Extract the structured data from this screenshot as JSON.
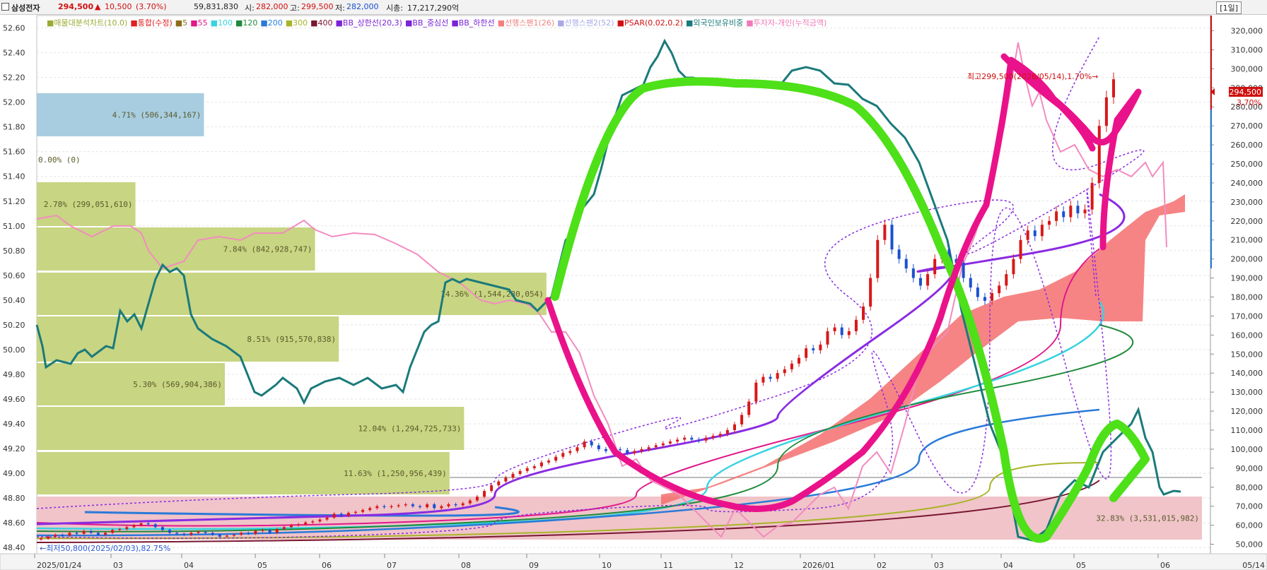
{
  "header": {
    "name": "삼성전자",
    "price": "294,500",
    "change_arrow": "▲",
    "change": "10,500",
    "change_pct": "(3.70%)",
    "volume": "59,831,830",
    "open_label": "시:",
    "open": "282,000",
    "high_label": "고:",
    "high": "299,500",
    "low_label": "저:",
    "low": "282,000",
    "mcap_label": "시총:",
    "mcap": "17,217,290억",
    "period": "[1일]"
  },
  "legend": [
    {
      "text": "매물대분석차트(10.0)",
      "color": "#9aaa33"
    },
    {
      "text": "통합(수정)",
      "color": "#e02020"
    },
    {
      "text": "5",
      "color": "#8b6d1a"
    },
    {
      "text": "55",
      "color": "#e0188a"
    },
    {
      "text": "100",
      "color": "#37d3e0"
    },
    {
      "text": "120",
      "color": "#1e8a3a"
    },
    {
      "text": "200",
      "color": "#2a7ad8"
    },
    {
      "text": "300",
      "color": "#a8b428"
    },
    {
      "text": "400",
      "color": "#7a1630"
    },
    {
      "text": "BB_상한선(20,3)",
      "color": "#7a22d8"
    },
    {
      "text": "BB_중심선",
      "color": "#7a22d8"
    },
    {
      "text": "BB_하한선",
      "color": "#7a22d8"
    },
    {
      "text": "선행스팬1(26)",
      "color": "#f08080"
    },
    {
      "text": "선행스팬2(52)",
      "color": "#a8a8e8"
    },
    {
      "text": "PSAR(0.02,0.2)",
      "color": "#d01010"
    },
    {
      "text": "외국인보유비중",
      "color": "#1a7a7a"
    },
    {
      "text": "투자자-개인(누적금액)",
      "color": "#f07ab8"
    }
  ],
  "colors": {
    "volume_profile": "#c8d582",
    "volume_profile_current": "#f0c4c9",
    "volume_profile_max_band": "#a8cde0",
    "foreign_ownership": "#1a7a7a",
    "individual_cumulative": "#f28cc0",
    "hand_green": "#4ee018",
    "hand_magenta": "#ea128a",
    "ichimoku_cloud": "#f56e6e",
    "bb": "#8a2be2",
    "up_candle": "#d81818",
    "down_candle": "#1a50d0"
  },
  "annotations": {
    "high_label": "최고299,500(2026/05/14),1.70%→",
    "low_label": "←최저50,800(2025/02/03),82.75%",
    "price_tag": "294,500",
    "pct_tag": "3.70%",
    "bottom_right_date": "05/14"
  },
  "chart_data": {
    "type": "candlestick",
    "x_tick_labels": [
      "2025/01/24",
      "03",
      "04",
      "05",
      "06",
      "07",
      "08",
      "09",
      "10",
      "11",
      "12",
      "2026/01",
      "02",
      "03",
      "04",
      "05",
      "06"
    ],
    "left_axis": {
      "label": "외국인보유비중",
      "ticks": [
        52.6,
        52.4,
        52.2,
        52.0,
        51.8,
        51.6,
        51.4,
        51.2,
        51.0,
        50.8,
        50.6,
        50.4,
        50.2,
        50.0,
        49.8,
        49.6,
        49.4,
        49.2,
        49.0,
        48.8,
        48.6,
        48.4
      ],
      "range": [
        48.35,
        52.7
      ]
    },
    "right_axis": {
      "ticks": [
        "320,000",
        "310,000",
        "300,000",
        "290,000",
        "280,000",
        "270,000",
        "260,000",
        "250,000",
        "240,000",
        "230,000",
        "220,000",
        "210,000",
        "200,000",
        "190,000",
        "180,000",
        "170,000",
        "160,000",
        "150,000",
        "140,000",
        "130,000",
        "120,000",
        "110,000",
        "100,000",
        "90,000",
        "80,000",
        "70,000",
        "60,000",
        "50,000"
      ],
      "range": [
        45000,
        328000
      ]
    },
    "volume_profile": [
      {
        "label": "4.71% (506,344,167)",
        "pct": 4.71
      },
      {
        "label": "0.00% (0)",
        "pct": 0.0
      },
      {
        "label": "2.78% (299,051,610)",
        "pct": 2.78
      },
      {
        "label": "7.84% (842,928,747)",
        "pct": 7.84
      },
      {
        "label": "14.36% (1,544,280,054)",
        "pct": 14.36
      },
      {
        "label": "8.51% (915,570,838)",
        "pct": 8.51
      },
      {
        "label": "5.30% (569,904,386)",
        "pct": 5.3
      },
      {
        "label": "12.04% (1,294,725,733)",
        "pct": 12.04
      },
      {
        "label": "11.63% (1,250,956,439)",
        "pct": 11.63
      },
      {
        "label": "32.83% (3,531,015,982)",
        "pct": 32.83
      }
    ],
    "close_prices": [
      53000,
      54000,
      55000,
      54500,
      56000,
      55500,
      57000,
      56000,
      55000,
      56000,
      57500,
      58000,
      59000,
      60000,
      61000,
      60500,
      59000,
      57500,
      56000,
      55500,
      55000,
      56000,
      56500,
      56000,
      55000,
      54000,
      54500,
      55000,
      56000,
      55500,
      57000,
      57500,
      56000,
      58000,
      59000,
      60000,
      60500,
      61500,
      62000,
      63000,
      64000,
      66000,
      65000,
      66500,
      67000,
      68000,
      69000,
      70000,
      69500,
      70000,
      70500,
      71000,
      70000,
      69500,
      71000,
      69000,
      70000,
      71000,
      70500,
      71500,
      73000,
      75000,
      78000,
      81000,
      83000,
      85000,
      87000,
      88500,
      90000,
      91000,
      93000,
      94000,
      96000,
      98000,
      99000,
      101000,
      104000,
      102000,
      100000,
      99000,
      100000,
      99500,
      98000,
      99000,
      100000,
      101000,
      102000,
      103000,
      104000,
      105000,
      106000,
      105000,
      104500,
      106000,
      107000,
      108000,
      110000,
      113000,
      118000,
      125000,
      135000,
      138000,
      137000,
      140000,
      142000,
      145000,
      148000,
      153000,
      152000,
      155000,
      162000,
      164000,
      160000,
      162000,
      168000,
      175000,
      190000,
      210000,
      218000,
      205000,
      200000,
      195000,
      190000,
      186000,
      192000,
      200000,
      205000,
      200000,
      198000,
      190000,
      185000,
      180000,
      178000,
      182000,
      186000,
      192000,
      200000,
      210000,
      215000,
      212000,
      218000,
      220000,
      225000,
      222000,
      228000,
      224000,
      226000,
      240000,
      270000,
      285000,
      294500
    ],
    "foreign_ownership_range": [
      48.6,
      52.64
    ],
    "individual_cumulative_range": [
      "low",
      "high"
    ]
  }
}
